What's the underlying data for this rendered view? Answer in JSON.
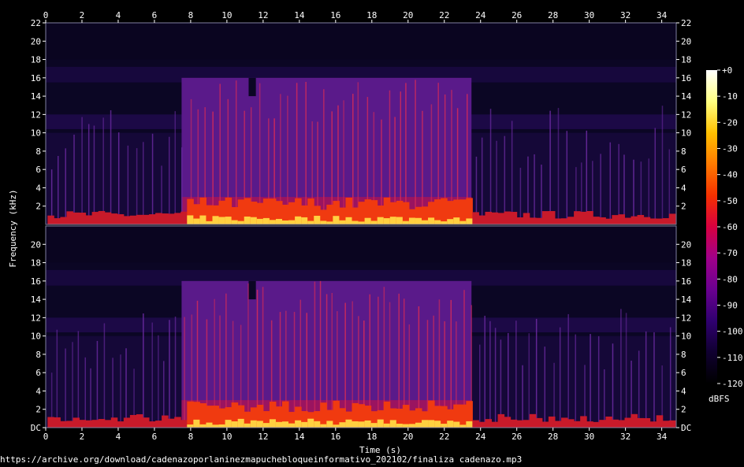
{
  "chart_data": {
    "type": "heatmap",
    "subtype": "spectrogram",
    "channels": 2,
    "xlabel": "Time (s)",
    "ylabel": "Frequency (kHz)",
    "xlim": [
      0,
      34.8
    ],
    "ylim": [
      0,
      22
    ],
    "x_ticks": [
      "0",
      "2",
      "4",
      "6",
      "8",
      "10",
      "12",
      "14",
      "16",
      "18",
      "20",
      "22",
      "24",
      "26",
      "28",
      "30",
      "32",
      "34"
    ],
    "y_ticks_top": [
      "22",
      "20",
      "18",
      "16",
      "14",
      "12",
      "10",
      "8",
      "6",
      "4",
      "2"
    ],
    "y_ticks_bottom": [
      "DC",
      "2",
      "4",
      "6",
      "8",
      "10",
      "12",
      "14",
      "16",
      "18",
      "20"
    ],
    "colorbar": {
      "unit": "dBFS",
      "range": [
        -120,
        0
      ],
      "ticks": [
        "+0",
        "-10",
        "-20",
        "-30",
        "-40",
        "-50",
        "-60",
        "-70",
        "-80",
        "-90",
        "-100",
        "-110",
        "-120"
      ],
      "colors": [
        "#000000",
        "#100030",
        "#300070",
        "#6a0090",
        "#a0008a",
        "#d80040",
        "#f53000",
        "#ff7a00",
        "#ffc000",
        "#ffff80",
        "#ffffff"
      ]
    },
    "loud_segment_s": [
      7.5,
      23.5
    ],
    "loud_segment_cutoff_khz": 16,
    "gap_s": [
      11.2,
      11.6
    ],
    "grid": false
  },
  "source_url": "https://archive.org/download/cadenazoporlaninezmapuchebloqueinformativo_202102/finaliza cadenazo.mp3"
}
